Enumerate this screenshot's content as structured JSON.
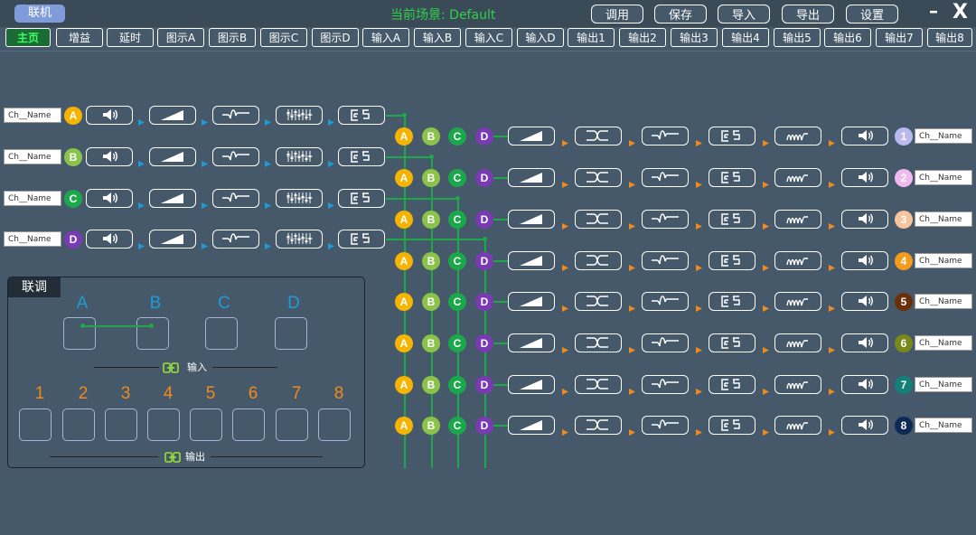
{
  "app": {
    "link_button": "联机",
    "scene": "当前场景: Default",
    "actions": [
      "调用",
      "保存",
      "导入",
      "导出",
      "设置"
    ],
    "minimize": "–",
    "close": "X"
  },
  "tabs": [
    "主页",
    "增益",
    "延时",
    "图示A",
    "图示B",
    "图示C",
    "图示D",
    "输入A",
    "输入B",
    "输入C",
    "输入D",
    "输出1",
    "输出2",
    "输出3",
    "输出4",
    "输出5",
    "输出6",
    "输出7",
    "输出8"
  ],
  "active_tab": "主页",
  "inputs": [
    {
      "name": "Ch__Name",
      "badge": "A",
      "color": "#f6b400"
    },
    {
      "name": "Ch__Name",
      "badge": "B",
      "color": "#8bc34a"
    },
    {
      "name": "Ch__Name",
      "badge": "C",
      "color": "#1aa84a"
    },
    {
      "name": "Ch__Name",
      "badge": "D",
      "color": "#7a3ab3"
    }
  ],
  "input_chain_icons": [
    "speaker-icon",
    "gain-ramp-icon",
    "eq-curve-icon",
    "fader-bank-icon",
    "delay-icon"
  ],
  "bus_badges": [
    {
      "label": "A",
      "color": "#f6b400"
    },
    {
      "label": "B",
      "color": "#8bc34a"
    },
    {
      "label": "C",
      "color": "#1aa84a"
    },
    {
      "label": "D",
      "color": "#7a3ab3"
    }
  ],
  "outputs": [
    {
      "name": "Ch__Name",
      "badge": "1",
      "color": "#b9b9f0"
    },
    {
      "name": "Ch__Name",
      "badge": "2",
      "color": "#f2b8f0"
    },
    {
      "name": "Ch__Name",
      "badge": "3",
      "color": "#f7c39a"
    },
    {
      "name": "Ch__Name",
      "badge": "4",
      "color": "#f39b1c"
    },
    {
      "name": "Ch__Name",
      "badge": "5",
      "color": "#6b2e0a"
    },
    {
      "name": "Ch__Name",
      "badge": "6",
      "color": "#7a8a1a"
    },
    {
      "name": "Ch__Name",
      "badge": "7",
      "color": "#14807a"
    },
    {
      "name": "Ch__Name",
      "badge": "8",
      "color": "#0c2a55"
    }
  ],
  "output_chain_icons": [
    "gain-ramp-icon",
    "crossover-icon",
    "eq-curve-icon",
    "delay-icon",
    "limiter-icon",
    "speaker-icon"
  ],
  "link_panel": {
    "title": "联调",
    "input_labels": [
      "A",
      "B",
      "C",
      "D"
    ],
    "input_caption": "输入",
    "output_labels": [
      "1",
      "2",
      "3",
      "4",
      "5",
      "6",
      "7",
      "8"
    ],
    "output_caption": "输出",
    "linked_inputs": [
      "A",
      "B"
    ]
  },
  "colors": {
    "background": "#46596a",
    "wire": "#1ea84a",
    "input_arrow": "#1e9bd7",
    "output_arrow": "#f08a1c",
    "input_link_label": "#1e9bd7",
    "output_link_label": "#f08a1c"
  }
}
